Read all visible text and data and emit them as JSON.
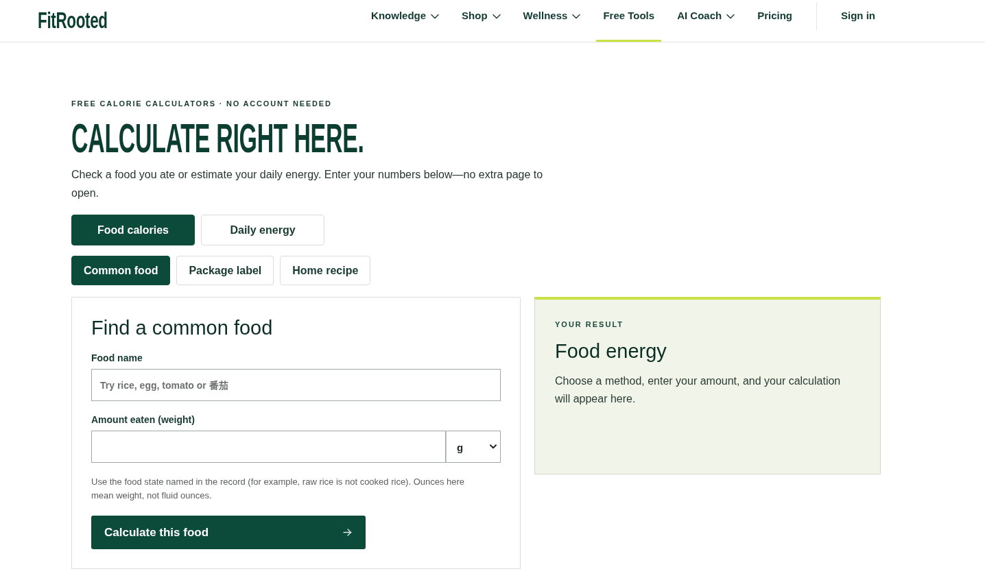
{
  "header": {
    "logo": "FitRooted",
    "nav": [
      {
        "label": "Knowledge",
        "has_menu": true,
        "selected": false
      },
      {
        "label": "Shop",
        "has_menu": true,
        "selected": false
      },
      {
        "label": "Wellness",
        "has_menu": true,
        "selected": false
      },
      {
        "label": "Free Tools",
        "has_menu": false,
        "selected": true
      },
      {
        "label": "AI Coach",
        "has_menu": true,
        "selected": false
      },
      {
        "label": "Pricing",
        "has_menu": false,
        "selected": false
      }
    ],
    "sign_in": "Sign in"
  },
  "hero": {
    "eyebrow": "FREE CALORIE CALCULATORS · NO ACCOUNT NEEDED",
    "title": "CALCULATE RIGHT HERE.",
    "intro": "Check a food you ate or estimate your daily energy. Enter your numbers below—no extra page to open."
  },
  "mode_tabs": [
    {
      "label": "Food calories",
      "selected": true
    },
    {
      "label": "Daily energy",
      "selected": false
    }
  ],
  "method_tabs": [
    {
      "label": "Common food",
      "selected": true
    },
    {
      "label": "Package label",
      "selected": false
    },
    {
      "label": "Home recipe",
      "selected": false
    }
  ],
  "form": {
    "title": "Find a common food",
    "fields": [
      {
        "kind": "text",
        "label": "Food name",
        "placeholder": "Try rice, egg, tomato or 番茄"
      },
      {
        "kind": "amount",
        "label": "Amount eaten (weight)",
        "unit": "g"
      }
    ],
    "hint": "Use the food state named in the record (for example, raw rice is not cooked rice). Ounces here mean weight, not fluid ounces.",
    "submit": "Calculate this food"
  },
  "result": {
    "eyebrow": "YOUR RESULT",
    "title": "Food energy",
    "message": "Choose a method, enter your amount, and your calculation will appear here."
  }
}
